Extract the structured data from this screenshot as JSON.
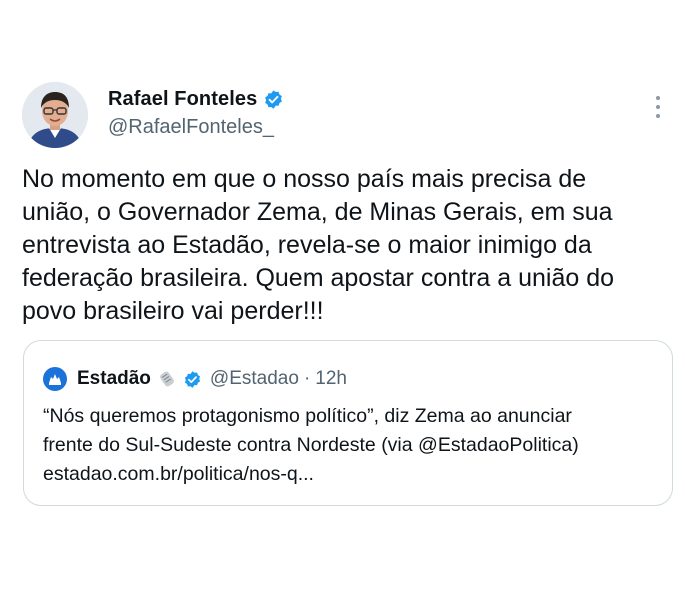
{
  "author": {
    "display_name": "Rafael Fonteles",
    "handle": "@RafaelFonteles_",
    "verified": true
  },
  "tweet": {
    "text": "No momento em que o nosso país mais precisa de\nunião, o Governador Zema, de Minas Gerais, em sua\nentrevista ao Estadão, revela-se o maior inimigo da\nfederação brasileira. Quem apostar contra a união do\npovo brasileiro vai perder!!!"
  },
  "quoted_tweet": {
    "display_name": "Estadão",
    "handle": "@Estadao",
    "separator": "·",
    "time": "12h",
    "text": "“Nós queremos protagonismo político”, diz Zema ao anunciar\nfrente do Sul-Sudeste contra Nordeste (via @EstadaoPolitica)\nestadao.com.br/politica/nos-q..."
  },
  "icons": {
    "verified": "verified-badge-icon",
    "more": "more-options-icon",
    "newspaper": "newspaper-icon"
  },
  "colors": {
    "verified_blue": "#1d9bf0",
    "estadao_blue": "#1a73d9",
    "secondary_text": "#536471",
    "border": "#cfd9de"
  }
}
